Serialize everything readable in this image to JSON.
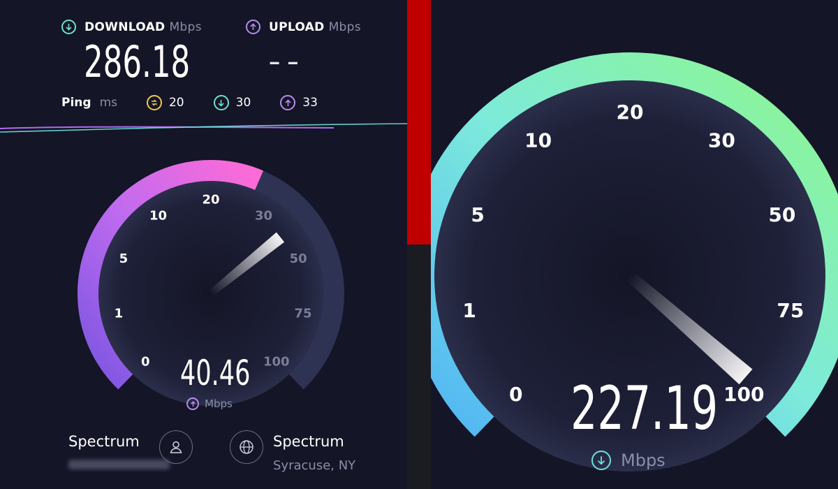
{
  "left_panel": {
    "download": {
      "label": "DOWNLOAD",
      "unit": "Mbps",
      "value": "286.18",
      "icon": "arrow-down-circle-icon",
      "color": "#6fe0d3"
    },
    "upload": {
      "label": "UPLOAD",
      "unit": "Mbps",
      "value": "– –",
      "icon": "arrow-up-circle-icon",
      "color": "#b78cf0"
    },
    "ping": {
      "label": "Ping",
      "unit": "ms",
      "idle": {
        "value": "20",
        "icon": "ping-idle-icon",
        "color": "#f2c94c"
      },
      "download": {
        "value": "30",
        "icon": "arrow-down-circle-icon",
        "color": "#6fe0d3"
      },
      "upload": {
        "value": "33",
        "icon": "arrow-up-circle-icon",
        "color": "#b78cf0"
      }
    },
    "gauge": {
      "ticks": [
        "0",
        "1",
        "5",
        "10",
        "20",
        "30",
        "50",
        "75",
        "100"
      ],
      "current_value": "40.46",
      "unit": "Mbps",
      "unit_icon": "arrow-up-circle-icon",
      "fill_fraction": 0.585,
      "colors": [
        "#7a55e0",
        "#c06bf0",
        "#ff6bd6"
      ]
    },
    "isp": {
      "name": "Spectrum",
      "icon": "user-icon"
    },
    "server": {
      "name": "Spectrum",
      "location": "Syracuse, NY",
      "icon": "globe-icon"
    }
  },
  "right_panel": {
    "gauge": {
      "ticks": [
        "0",
        "1",
        "5",
        "10",
        "20",
        "30",
        "50",
        "75",
        "100"
      ],
      "current_value": "227.19",
      "unit": "Mbps",
      "unit_icon": "arrow-down-circle-icon",
      "fill_fraction": 1.0,
      "colors": [
        "#4fb3f5",
        "#7deadb",
        "#8ef78a"
      ]
    }
  }
}
